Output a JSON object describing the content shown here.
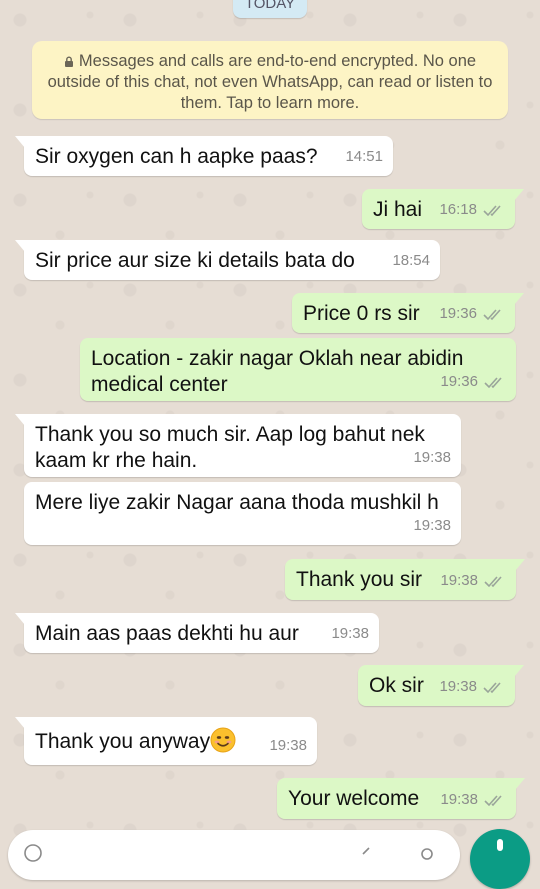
{
  "chat": {
    "date_chip": "TODAY",
    "encryption_notice": "Messages and calls are end-to-end encrypted. No one outside of this chat, not even WhatsApp, can read or listen to them. Tap to learn more.",
    "messages": [
      {
        "direction": "in",
        "text": "Sir oxygen can h aapke paas?",
        "time": "14:51"
      },
      {
        "direction": "out",
        "text": "Ji hai",
        "time": "16:18",
        "status": "read"
      },
      {
        "direction": "in",
        "text": "Sir price aur size ki details bata do",
        "time": "18:54"
      },
      {
        "direction": "out",
        "text": "Price 0 rs sir",
        "time": "19:36",
        "status": "read"
      },
      {
        "direction": "out",
        "text": "Location - zakir nagar Oklah near abidin medical center",
        "time": "19:36",
        "status": "read"
      },
      {
        "direction": "in",
        "text": "Thank you so much sir. Aap log bahut nek kaam kr rhe hain.",
        "time": "19:38"
      },
      {
        "direction": "in",
        "text": "Mere liye zakir Nagar aana thoda mushkil h",
        "time": "19:38"
      },
      {
        "direction": "out",
        "text": "Thank you sir",
        "time": "19:38",
        "status": "read"
      },
      {
        "direction": "in",
        "text": "Main aas paas dekhti hu aur",
        "time": "19:38"
      },
      {
        "direction": "out",
        "text": "Ok sir",
        "time": "19:38",
        "status": "read"
      },
      {
        "direction": "in",
        "text": "Thank you anyway",
        "emoji": "smiling-face-emoji",
        "time": "19:38"
      },
      {
        "direction": "out",
        "text": "Your welcome",
        "time": "19:38",
        "status": "read"
      }
    ]
  },
  "colors": {
    "incoming_bubble": "#ffffff",
    "outgoing_bubble": "#dcf8c6",
    "encryption_banner": "#fdf4c5",
    "read_tick": "#9aa59a",
    "send_button": "#0b9c85"
  },
  "icons": [
    "lock-icon",
    "double-check-icon",
    "smiling-face-emoji",
    "emoji-icon",
    "attach-icon",
    "camera-icon",
    "mic-icon"
  ]
}
